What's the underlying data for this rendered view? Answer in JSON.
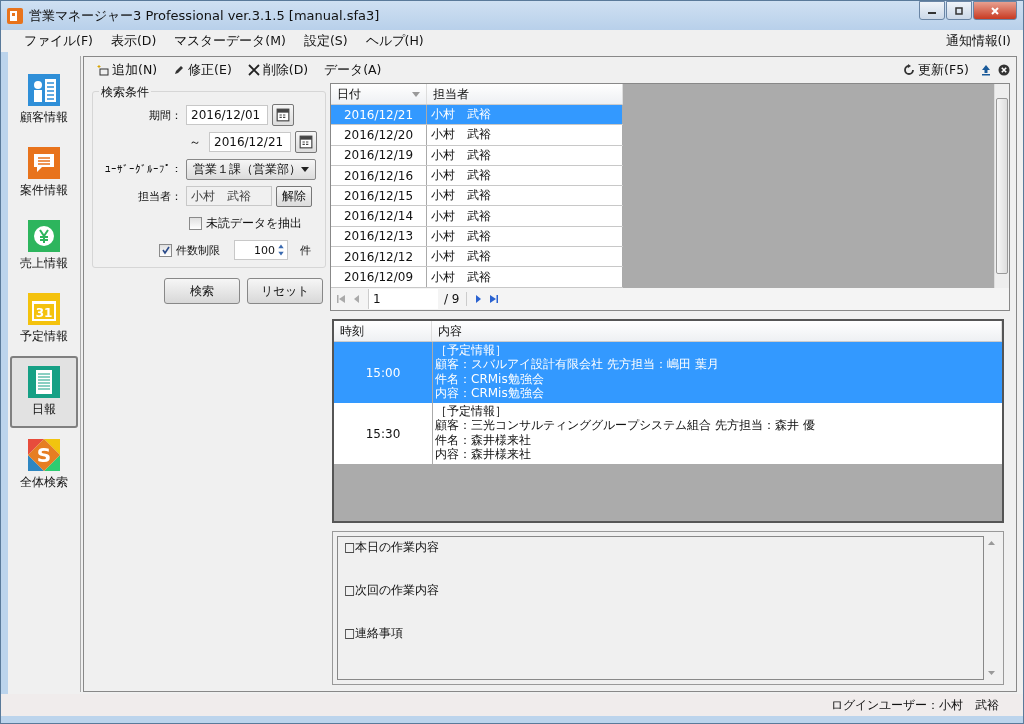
{
  "window": {
    "title": "営業マネージャー3 Professional ver.3.1.5 [manual.sfa3]"
  },
  "menu": {
    "items": [
      "ファイル(F)",
      "表示(D)",
      "マスターデータ(M)",
      "設定(S)",
      "ヘルプ(H)"
    ],
    "notice": "通知情報(I)"
  },
  "sidebar": {
    "items": [
      {
        "label": "顧客情報",
        "kind": "customer",
        "selected": false
      },
      {
        "label": "案件情報",
        "kind": "case",
        "selected": false
      },
      {
        "label": "売上情報",
        "kind": "sales",
        "selected": false
      },
      {
        "label": "予定情報",
        "kind": "schedule",
        "icon_text": "31",
        "selected": false
      },
      {
        "label": "日報",
        "kind": "report",
        "selected": true
      },
      {
        "label": "全体検索",
        "kind": "search",
        "icon_text": "S",
        "selected": false
      }
    ]
  },
  "toolbar": {
    "items": [
      {
        "label": "追加(N)",
        "kind": "add"
      },
      {
        "label": "修正(E)",
        "kind": "edit"
      },
      {
        "label": "削除(D)",
        "kind": "delete"
      },
      {
        "label": "データ(A)",
        "kind": "plain"
      }
    ],
    "refresh": "更新(F5)"
  },
  "search": {
    "legend": "検索条件",
    "period_label": "期間：",
    "from": "2016/12/01",
    "tilde": "～",
    "to": "2016/12/21",
    "group_label": "ﾕｰｻﾞｰｸﾞﾙｰﾌﾟ：",
    "group": "営業１課（営業部）",
    "person_label": "担当者：",
    "person": "小村　武裕",
    "clear": "解除",
    "unread": {
      "label": "未読データを抽出",
      "checked": false
    },
    "limit": {
      "label": "件数制限",
      "checked": true,
      "value": "100",
      "unit": "件"
    },
    "buttons": [
      "検索",
      "リセット"
    ]
  },
  "list": {
    "columns": [
      "日付",
      "担当者"
    ],
    "rows": [
      {
        "date": "2016/12/21",
        "person": "小村　武裕",
        "selected": true
      },
      {
        "date": "2016/12/20",
        "person": "小村　武裕",
        "selected": false
      },
      {
        "date": "2016/12/19",
        "person": "小村　武裕",
        "selected": false
      },
      {
        "date": "2016/12/16",
        "person": "小村　武裕",
        "selected": false
      },
      {
        "date": "2016/12/15",
        "person": "小村　武裕",
        "selected": false
      },
      {
        "date": "2016/12/14",
        "person": "小村　武裕",
        "selected": false
      },
      {
        "date": "2016/12/13",
        "person": "小村　武裕",
        "selected": false
      },
      {
        "date": "2016/12/12",
        "person": "小村　武裕",
        "selected": false
      },
      {
        "date": "2016/12/09",
        "person": "小村　武裕",
        "selected": false
      }
    ],
    "pager": {
      "page": "1",
      "total": "/ 9"
    }
  },
  "schedule": {
    "columns": [
      "時刻",
      "内容"
    ],
    "rows": [
      {
        "time": "15:00",
        "lines": [
          "［予定情報］",
          "顧客：スバルアイ設計有限会社 先方担当：嶋田 葉月",
          "件名：CRMis勉強会",
          "内容：CRMis勉強会"
        ],
        "selected": true
      },
      {
        "time": "15:30",
        "lines": [
          "［予定情報］",
          "顧客：三光コンサルティンググループシステム組合 先方担当：森井 優",
          "件名：森井様来社",
          "内容：森井様来社"
        ],
        "selected": false
      }
    ]
  },
  "memo": {
    "lines": [
      "□本日の作業内容",
      "□次回の作業内容",
      "□連絡事項"
    ]
  },
  "status_bar": {
    "user": "ログインユーザー：小村　武裕"
  }
}
